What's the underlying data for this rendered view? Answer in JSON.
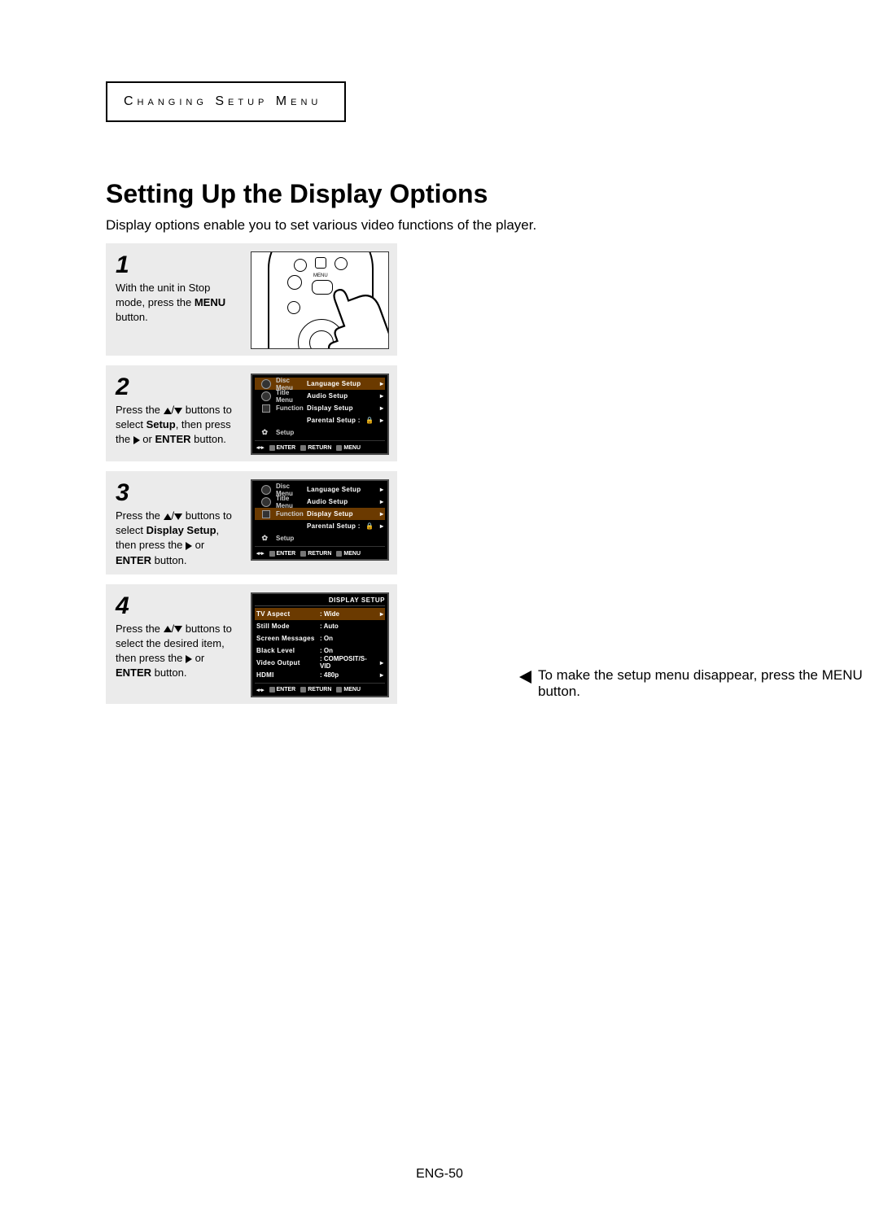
{
  "chapter": "Changing Setup Menu",
  "title": "Setting Up the Display Options",
  "intro": "Display options enable you to set various video functions of the player.",
  "steps": {
    "s1": {
      "num": "1",
      "p1": "With the unit in Stop mode, press the ",
      "b1": "MENU",
      "p2": " button."
    },
    "s2": {
      "num": "2",
      "p1": "Press the ",
      "mid": " buttons to select ",
      "b1": "Setup",
      "p2": ", then press the ",
      "p3": " or ",
      "b2": "ENTER",
      "p4": " button."
    },
    "s3": {
      "num": "3",
      "p1": "Press the ",
      "mid": " buttons to select ",
      "b1": "Display Setup",
      "p2": ", then press the ",
      "p3": " or ",
      "b2": "ENTER",
      "p4": " button."
    },
    "s4": {
      "num": "4",
      "p1": "Press the ",
      "mid": " buttons to select the desired item, then press the ",
      "p3": " or ",
      "b2": "ENTER",
      "p4": " button."
    }
  },
  "osd_side": {
    "disc": "Disc Menu",
    "title": "Title Menu",
    "func": "Function",
    "setup": "Setup"
  },
  "osd2": {
    "r1": "Language Setup",
    "r2": "Audio Setup",
    "r3": "Display Setup",
    "r4": "Parental Setup :"
  },
  "osd4": {
    "header": "DISPLAY SETUP",
    "rows": [
      {
        "k": "TV Aspect",
        "v": ": Wide",
        "hl": true,
        "arrow": true
      },
      {
        "k": "Still Mode",
        "v": ": Auto"
      },
      {
        "k": "Screen Messages",
        "v": ": On"
      },
      {
        "k": "Black Level",
        "v": ": On"
      },
      {
        "k": "Video Output",
        "v": ": COMPOSIT/S-VID",
        "arrow": true
      },
      {
        "k": "HDMI",
        "v": ": 480p",
        "arrow": true
      }
    ]
  },
  "osd_footer": {
    "enter": "ENTER",
    "return": "RETURN",
    "menu": "MENU"
  },
  "note": "To make the setup menu disappear, press the MENU button.",
  "pagenum": "ENG-50"
}
